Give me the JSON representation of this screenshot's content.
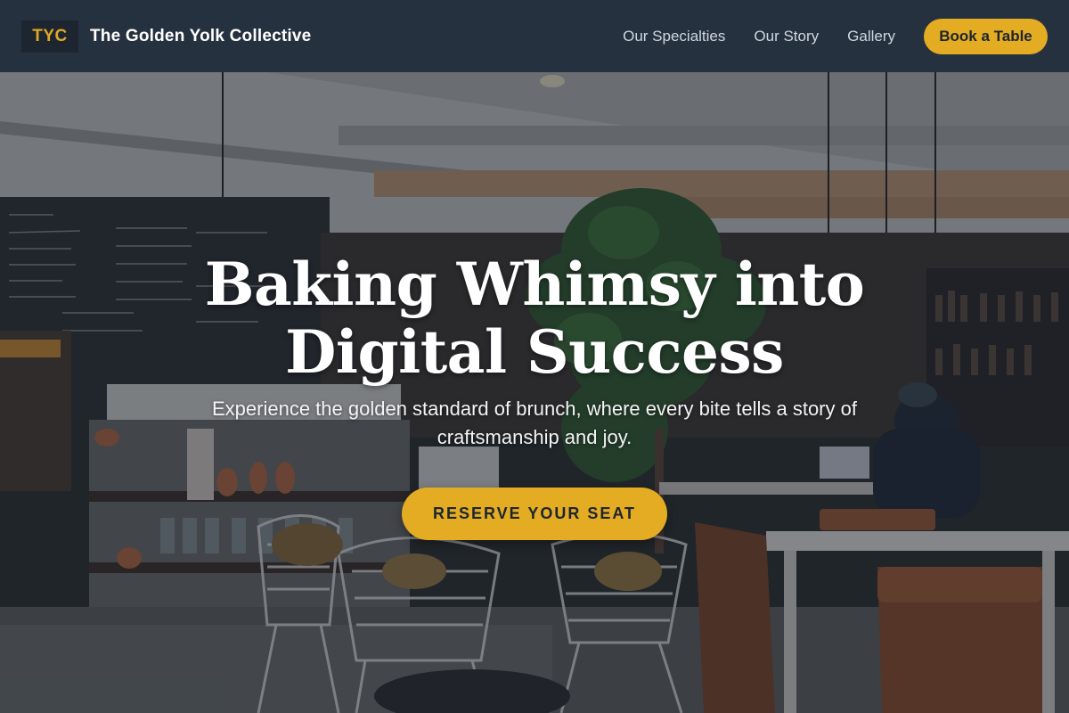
{
  "header": {
    "logo_text": "TYC",
    "brand_name": "The Golden Yolk Collective",
    "nav": [
      {
        "label": "Our Specialties"
      },
      {
        "label": "Our Story"
      },
      {
        "label": "Gallery"
      }
    ],
    "cta_label": "Book a Table"
  },
  "hero": {
    "title": "Baking Whimsy into Digital Success",
    "subtitle": "Experience the golden standard of brunch, where every bite tells a story of craftsmanship and joy.",
    "button_label": "RESERVE YOUR SEAT",
    "background_alt": "Cafe interior with chalkboard menu, plants and wire chairs"
  },
  "colors": {
    "header_bg": "#263140",
    "accent": "#e3ac22",
    "overlay": "#161e2c"
  }
}
